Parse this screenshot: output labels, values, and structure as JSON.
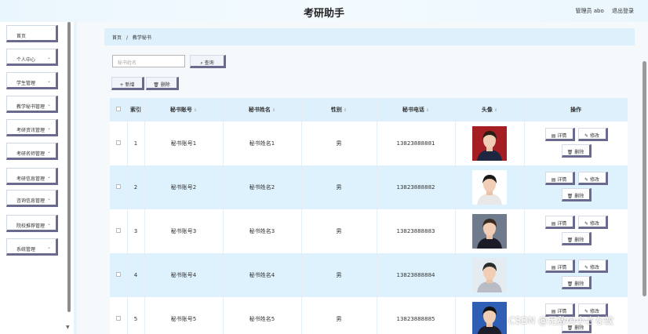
{
  "header": {
    "title": "考研助手",
    "user_label": "管理员 abo",
    "logout_label": "退出登录"
  },
  "sidebar": {
    "items": [
      {
        "label": "首页",
        "has_chevron": false
      },
      {
        "label": "个人中心",
        "has_chevron": true
      },
      {
        "label": "学生管理",
        "has_chevron": true
      },
      {
        "label": "教学秘书管理",
        "has_chevron": true
      },
      {
        "label": "考研资讯管理",
        "has_chevron": true
      },
      {
        "label": "考研名师管理",
        "has_chevron": true
      },
      {
        "label": "考研信息管理",
        "has_chevron": true
      },
      {
        "label": "咨询信息管理",
        "has_chevron": true
      },
      {
        "label": "院校推荐管理",
        "has_chevron": true
      },
      {
        "label": "系统管理",
        "has_chevron": true
      }
    ]
  },
  "breadcrumb": {
    "home": "首页",
    "sep": "/",
    "current": "教学秘书"
  },
  "search": {
    "placeholder": "秘书姓名",
    "button_label": "查询"
  },
  "toolbar": {
    "add_label": "+ 新增",
    "delete_label": "删除"
  },
  "table": {
    "headers": {
      "index": "索引",
      "account": "秘书账号",
      "name": "秘书姓名",
      "gender": "性别",
      "phone": "秘书电话",
      "avatar": "头像",
      "ops": "操作"
    },
    "rows": [
      {
        "index": "1",
        "account": "秘书账号1",
        "name": "秘书姓名1",
        "gender": "男",
        "phone": "13823888881"
      },
      {
        "index": "2",
        "account": "秘书账号2",
        "name": "秘书姓名2",
        "gender": "男",
        "phone": "13823888882"
      },
      {
        "index": "3",
        "account": "秘书账号3",
        "name": "秘书姓名3",
        "gender": "男",
        "phone": "13823888883"
      },
      {
        "index": "4",
        "account": "秘书账号4",
        "name": "秘书姓名4",
        "gender": "男",
        "phone": "13823888884"
      },
      {
        "index": "5",
        "account": "秘书账号5",
        "name": "秘书姓名5",
        "gender": "男",
        "phone": "13823888885"
      }
    ],
    "ops": {
      "detail_label": "详情",
      "edit_label": "修改",
      "delete_label": "删除"
    }
  },
  "watermark": "CSDN @无敌の小さな蚊",
  "colors": {
    "accent": "#ddf0fb",
    "button_shadow": "#6a6a8e"
  }
}
